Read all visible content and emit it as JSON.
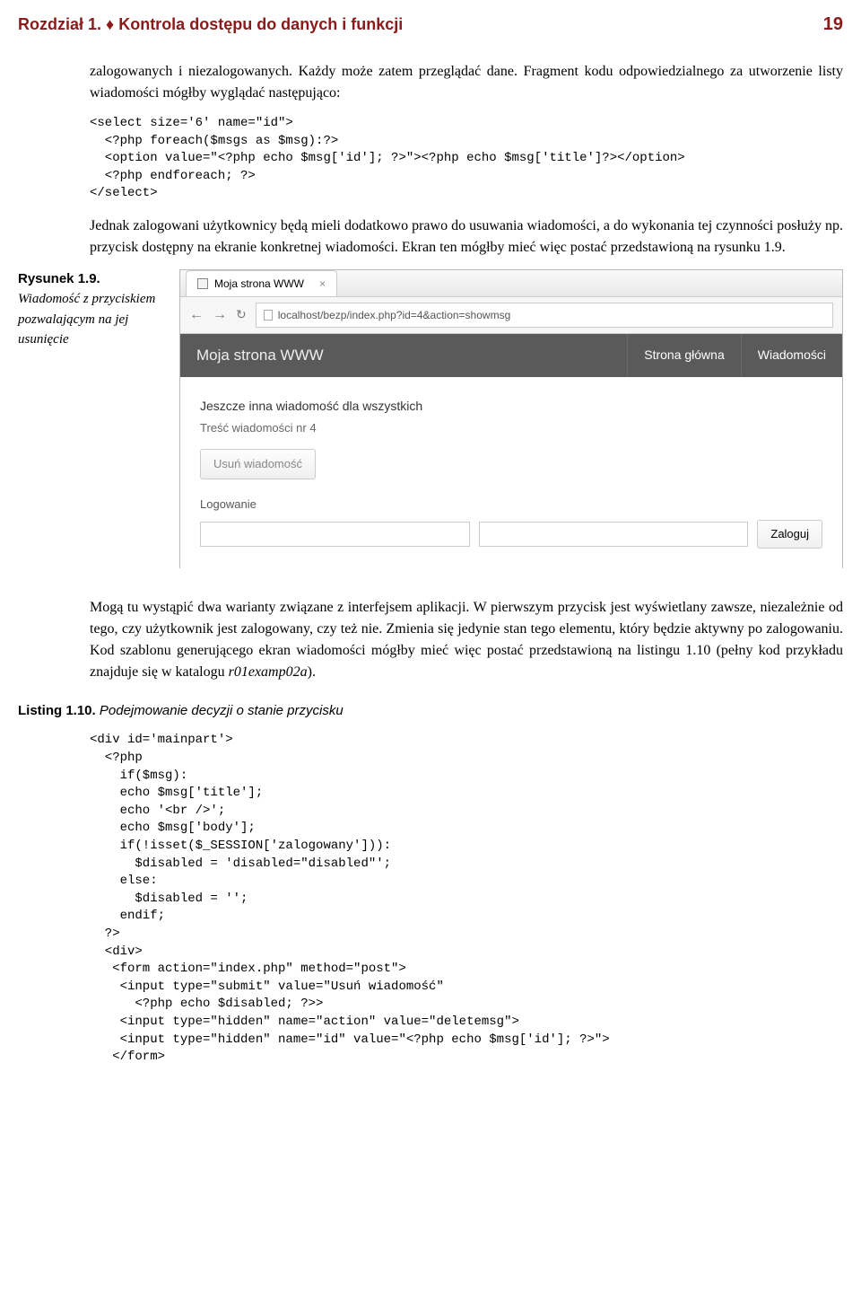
{
  "header": {
    "chapter": "Rozdział 1. ♦ Kontrola dostępu do danych i funkcji",
    "page": "19"
  },
  "para1": "zalogowanych i niezalogowanych. Każdy może zatem przeglądać dane. Fragment kodu odpowiedzialnego za utworzenie listy wiadomości mógłby wyglądać następująco:",
  "code1": "<select size='6' name=\"id\">\n  <?php foreach($msgs as $msg):?>\n  <option value=\"<?php echo $msg['id']; ?>\"><?php echo $msg['title']?></option>\n  <?php endforeach; ?>\n</select>",
  "para2": "Jednak zalogowani użytkownicy będą mieli dodatkowo prawo do usuwania wiadomości, a do wykonania tej czynności posłuży np. przycisk dostępny na ekranie konkretnej wiadomości. Ekran ten mógłby mieć więc postać przedstawioną na rysunku 1.9.",
  "figure": {
    "number": "Rysunek 1.9.",
    "description": "Wiadomość z przyciskiem pozwalającym na jej usunięcie"
  },
  "browser": {
    "tab_title": "Moja strona WWW",
    "url": "localhost/bezp/index.php?id=4&action=showmsg",
    "site_title": "Moja strona WWW",
    "nav_home": "Strona główna",
    "nav_msgs": "Wiadomości",
    "msg_title": "Jeszcze inna wiadomość dla wszystkich",
    "msg_body": "Treść wiadomości nr 4",
    "delete_btn": "Usuń wiadomość",
    "login_label": "Logowanie",
    "login_btn": "Zaloguj"
  },
  "para3_part1": "Mogą tu wystąpić dwa warianty związane z interfejsem aplikacji. W pierwszym przycisk jest wyświetlany zawsze, niezależnie od tego, czy użytkownik jest zalogowany, czy też nie. Zmienia się jedynie stan tego elementu, który będzie aktywny po zalogowaniu. Kod szablonu generującego ekran wiadomości mógłby mieć więc postać przedstawioną na listingu 1.10 (pełny kod przykładu znajduje się w katalogu ",
  "para3_ref": "r01examp02a",
  "para3_part2": ").",
  "listing": {
    "number": "Listing 1.10.",
    "title": "Podejmowanie decyzji o stanie przycisku"
  },
  "code2": "<div id='mainpart'>\n  <?php\n    if($msg):\n    echo $msg['title'];\n    echo '<br />';\n    echo $msg['body'];\n    if(!isset($_SESSION['zalogowany'])):\n      $disabled = 'disabled=\"disabled\"';\n    else:\n      $disabled = '';\n    endif;\n  ?>\n  <div>\n   <form action=\"index.php\" method=\"post\">\n    <input type=\"submit\" value=\"Usuń wiadomość\"\n      <?php echo $disabled; ?>>\n    <input type=\"hidden\" name=\"action\" value=\"deletemsg\">\n    <input type=\"hidden\" name=\"id\" value=\"<?php echo $msg['id']; ?>\">\n   </form>"
}
